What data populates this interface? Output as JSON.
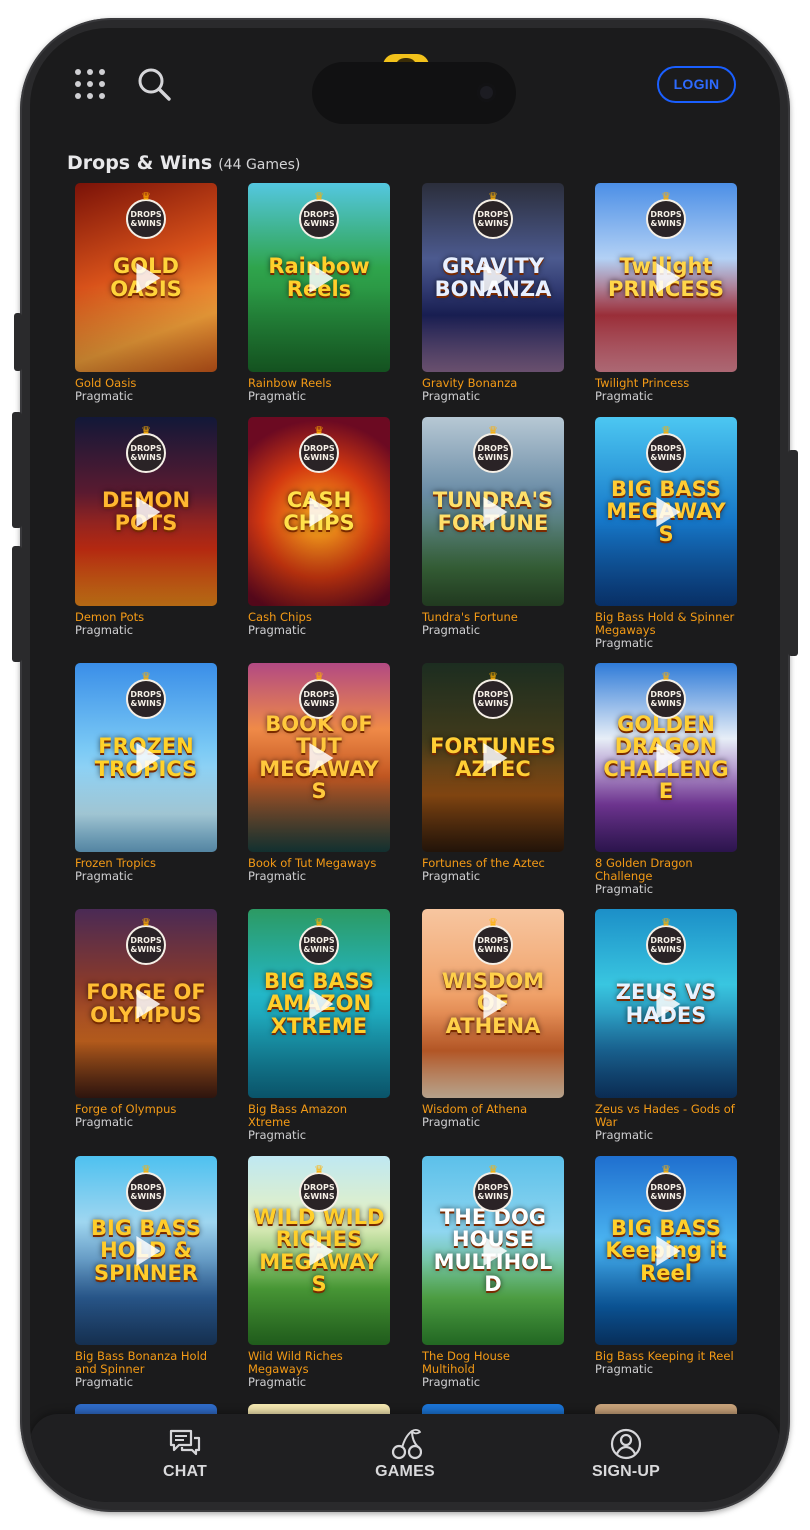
{
  "header": {
    "login_label": "LOGIN"
  },
  "section": {
    "title": "Drops & Wins",
    "count": "(44 Games)"
  },
  "badge_text": "DROPS\n&WINS",
  "games": [
    {
      "name": "Gold Oasis",
      "provider": "Pragmatic",
      "art": "GOLD OASIS",
      "bg": "linear-gradient(160deg,#7a1208 0%,#d8521a 45%,#f3a03a 75%,#d25b1b 100%)",
      "fg": "#ffd43b"
    },
    {
      "name": "Rainbow Reels",
      "provider": "Pragmatic",
      "art": "Rainbow Reels",
      "bg": "linear-gradient(180deg,#54c7e0 0%,#2fa44c 45%,#1a6d2a 100%)",
      "fg": "#ffcf2b"
    },
    {
      "name": "Gravity Bonanza",
      "provider": "Pragmatic",
      "art": "GRAVITY BONANZA",
      "bg": "linear-gradient(180deg,#2b2e3b 0%,#4c5a8f 40%,#1a2058 70%,#8c6a92 100%)",
      "fg": "#e8f0ff"
    },
    {
      "name": "Twilight Princess",
      "provider": "Pragmatic",
      "art": "Twilight PRINCESS",
      "bg": "linear-gradient(180deg,#4c8fe6 0%,#b3d1f5 40%,#a8323d 70%,#e58a9a 100%)",
      "fg": "#ffd64a"
    },
    {
      "name": "Demon Pots",
      "provider": "Pragmatic",
      "art": "DEMON POTS",
      "bg": "linear-gradient(180deg,#121838 0%,#5a1a30 40%,#c42c12 70%,#f08c1a 100%)",
      "fg": "#ffb830"
    },
    {
      "name": "Cash Chips",
      "provider": "Pragmatic",
      "art": "CASH CHIPS",
      "bg": "radial-gradient(circle at 50% 55%,#ffb21e 0%,#d33810 45%,#6c0a22 80%)",
      "fg": "#ffe14a"
    },
    {
      "name": "Tundra's Fortune",
      "provider": "Pragmatic",
      "art": "TUNDRA'S FORTUNE",
      "bg": "linear-gradient(180deg,#b7c8d4 0%,#6a8ca6 40%,#3b6a3c 80%,#2c4d2a 100%)",
      "fg": "#ffe06a"
    },
    {
      "name": "Big Bass Hold & Spinner Megaways",
      "provider": "Pragmatic",
      "art": "BIG BASS MEGAWAYS",
      "bg": "linear-gradient(180deg,#4cc7f2 0%,#1677c8 55%,#0b3f87 100%)",
      "fg": "#ffcc33"
    },
    {
      "name": "Frozen Tropics",
      "provider": "Pragmatic",
      "art": "FROZEN TROPICS",
      "bg": "linear-gradient(180deg,#3a8ee8 0%,#7ac9f5 45%,#b9e4f4 80%,#6fb1d8 100%)",
      "fg": "#ffd22a"
    },
    {
      "name": "Book of Tut Megaways",
      "provider": "Pragmatic",
      "art": "BOOK OF TUT MEGAWAYS",
      "bg": "linear-gradient(180deg,#b24a83 0%,#ef8a48 35%,#c45822 60%,#18403f 100%)",
      "fg": "#ffc93d"
    },
    {
      "name": "Fortunes of the Aztec",
      "provider": "Pragmatic",
      "art": "FORTUNES AZTEC",
      "bg": "linear-gradient(180deg,#1c2d20 0%,#3f3a1b 40%,#8b4a12 70%,#2e1a0c 100%)",
      "fg": "#ffcf35"
    },
    {
      "name": "8 Golden Dragon Challenge",
      "provider": "Pragmatic",
      "art": "GOLDEN DRAGON CHALLENGE",
      "bg": "linear-gradient(180deg,#2f7bd8 0%,#e7eef7 40%,#7a3aa0 75%,#3a1b66 100%)",
      "fg": "#ffcf35"
    },
    {
      "name": "Forge of Olympus",
      "provider": "Pragmatic",
      "art": "FORGE OF OLYMPUS",
      "bg": "linear-gradient(180deg,#4a2a55 0%,#8a3a2a 40%,#c2621e 70%,#3d1b12 100%)",
      "fg": "#ffbe34"
    },
    {
      "name": "Big Bass Amazon Xtreme",
      "provider": "Pragmatic",
      "art": "BIG BASS AMAZON XTREME",
      "bg": "linear-gradient(180deg,#2c9a63 0%,#23b7c8 45%,#0d6f8c 100%)",
      "fg": "#ffcf2b"
    },
    {
      "name": "Wisdom of Athena",
      "provider": "Pragmatic",
      "art": "WISDOM OF ATHENA",
      "bg": "linear-gradient(180deg,#f7c6a0 0%,#f0a26a 45%,#c8602a 75%,#f3d7b8 100%)",
      "fg": "#ffd04a"
    },
    {
      "name": "Zeus vs Hades - Gods of War",
      "provider": "Pragmatic",
      "art": "ZEUS VS HADES",
      "bg": "linear-gradient(180deg,#1c8fc8 0%,#39c6e0 40%,#1b6b9e 75%,#0e3a6e 100%)",
      "fg": "#e7f2ff"
    },
    {
      "name": "Big Bass Bonanza Hold and Spinner",
      "provider": "Pragmatic",
      "art": "BIG BASS HOLD & SPINNER",
      "bg": "linear-gradient(180deg,#4ec1f0 0%,#9fd6f0 35%,#2c5f98 75%,#1c3f6a 100%)",
      "fg": "#ffcc2b"
    },
    {
      "name": "Wild Wild Riches Megaways",
      "provider": "Pragmatic",
      "art": "WILD WILD RICHES MEGAWAYS",
      "bg": "linear-gradient(180deg,#bfe8f2 0%,#e6f1c2 35%,#4ea43a 70%,#2b7a25 100%)",
      "fg": "#ffcf2b"
    },
    {
      "name": "The Dog House Multihold",
      "provider": "Pragmatic",
      "art": "THE DOG HOUSE MULTIHOLD",
      "bg": "linear-gradient(180deg,#5cc0ea 0%,#8fd6f0 40%,#56b04a 75%,#2e8a2e 100%)",
      "fg": "#ffffff"
    },
    {
      "name": "Big Bass Keeping it Reel",
      "provider": "Pragmatic",
      "art": "BIG BASS Keeping it Reel",
      "bg": "linear-gradient(180deg,#1f6fcf 0%,#4ab3f0 45%,#0c5ea8 80%,#0a3e78 100%)",
      "fg": "#ffd02b"
    }
  ],
  "partial_row_colors": [
    "#2f6bc8",
    "#f4e7b0",
    "#1b74d6",
    "#c8a27a"
  ],
  "bottom_nav": [
    {
      "label": "CHAT",
      "icon": "chat-icon"
    },
    {
      "label": "GAMES",
      "icon": "cherries-icon"
    },
    {
      "label": "SIGN-UP",
      "icon": "user-icon"
    }
  ]
}
